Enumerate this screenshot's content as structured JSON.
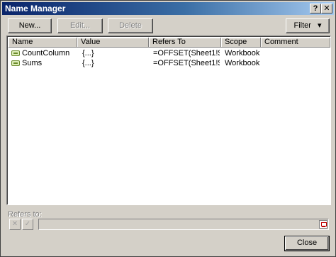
{
  "window": {
    "title": "Name Manager",
    "help_label": "?",
    "close_label": "✕"
  },
  "toolbar": {
    "new_label": "New...",
    "edit_label": "Edit...",
    "delete_label": "Delete",
    "filter_label": "Filter",
    "filter_arrow": "▾"
  },
  "list": {
    "columns": [
      "Name",
      "Value",
      "Refers To",
      "Scope",
      "Comment"
    ],
    "rows": [
      {
        "name": "CountColumn",
        "value": "{...}",
        "refers_to": "=OFFSET(Sheet1!$...",
        "scope": "Workbook",
        "comment": ""
      },
      {
        "name": "Sums",
        "value": "{...}",
        "refers_to": "=OFFSET(Sheet1!$...",
        "scope": "Workbook",
        "comment": ""
      }
    ]
  },
  "refers": {
    "label": "Refers to:",
    "value": "",
    "cancel_icon": "✕",
    "confirm_icon": "✓"
  },
  "footer": {
    "close_label": "Close"
  }
}
